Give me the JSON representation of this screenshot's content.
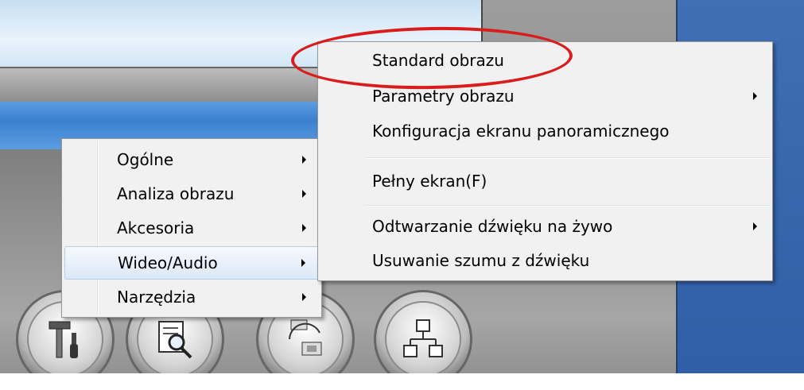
{
  "left_menu": {
    "items": [
      {
        "label": "Ogólne",
        "has_submenu": true
      },
      {
        "label": "Analiza obrazu",
        "has_submenu": true
      },
      {
        "label": "Akcesoria",
        "has_submenu": true
      },
      {
        "label": "Wideo/Audio",
        "has_submenu": true,
        "highlighted": true
      },
      {
        "label": "Narzędzia",
        "has_submenu": true
      }
    ]
  },
  "right_menu": {
    "items": [
      {
        "label": "Standard obrazu",
        "has_submenu": false
      },
      {
        "label": "Parametry obrazu",
        "has_submenu": true
      },
      {
        "label": "Konfiguracja ekranu panoramicznego",
        "has_submenu": false
      },
      {
        "label": "Pełny ekran(F)",
        "has_submenu": false
      },
      {
        "label": "Odtwarzanie dźwięku na żywo",
        "has_submenu": true
      },
      {
        "label": "Usuwanie szumu z dźwięku",
        "has_submenu": false
      }
    ]
  },
  "toolbar_icons": [
    "tools-icon",
    "document-search-icon",
    "device-setup-icon",
    "network-icon"
  ],
  "annotation": {
    "color": "#d91c1c",
    "target": "Standard obrazu"
  }
}
